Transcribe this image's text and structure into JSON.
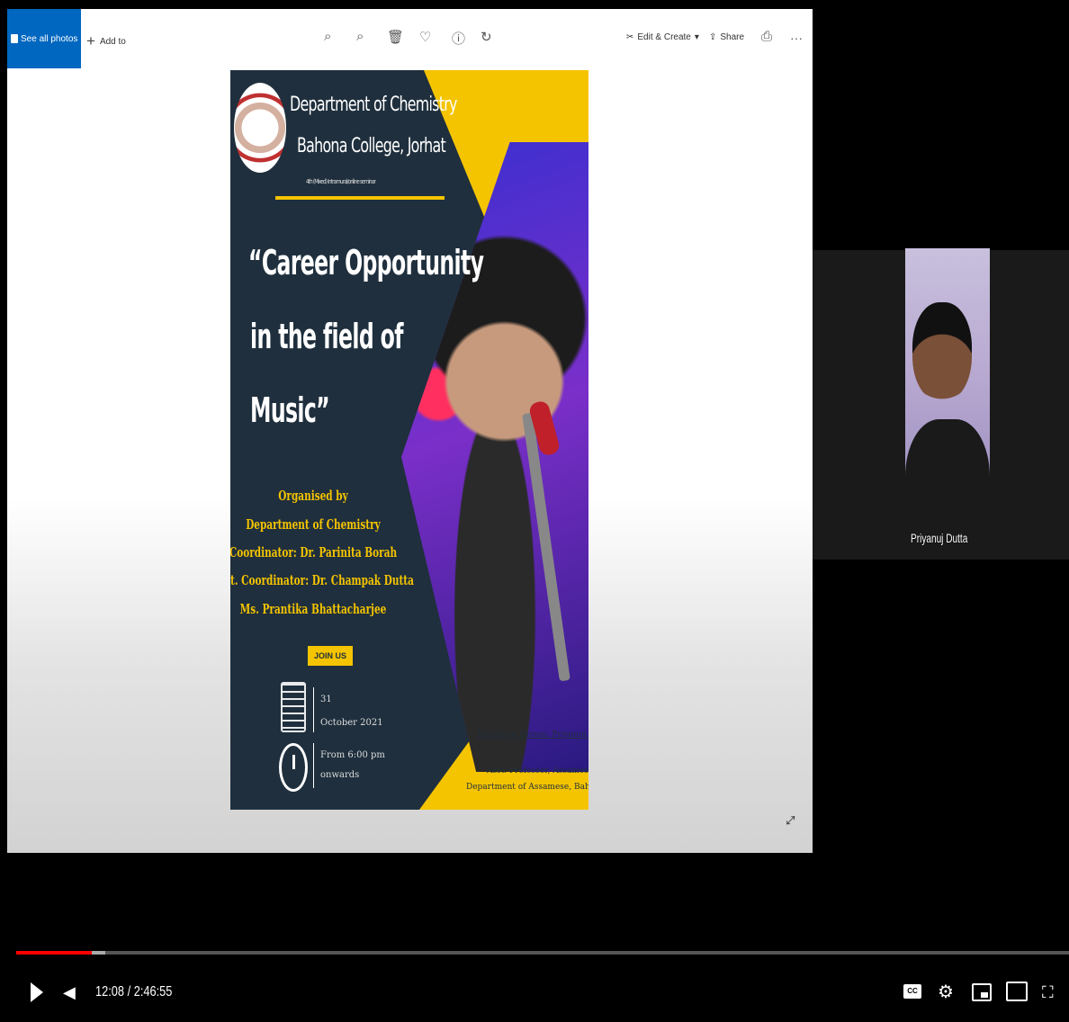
{
  "viewer": {
    "see_all_label": "See all photos",
    "add_to_label": "Add to",
    "edit_create_label": "Edit & Create",
    "share_label": "Share",
    "toolbar_icons": [
      "zoom-in-icon",
      "zoom-out-icon",
      "delete-icon",
      "favorite-icon",
      "info-icon",
      "rotate-icon"
    ]
  },
  "poster": {
    "dept_line1": "Department of Chemistry",
    "dept_line2": "Bahona College, Jorhat",
    "dept_line3": "4th (Mixed) Intramural/online seminar",
    "title_line1": "“Career Opportunity",
    "title_line2": "in the field of",
    "title_line3": "Music”",
    "organised_by": "Organised by",
    "organiser": "Department of Chemistry",
    "coordinator": "Coordinator: Dr. Parinita Borah",
    "asst_coordinator": "Asst. Coordinator: Dr. Champak Dutta",
    "member": "Ms. Prantika Bhattacharjee",
    "join_label": "JOIN US",
    "date_day": "31",
    "date_month": "October 2021",
    "time_line1": "From 6:00 pm",
    "time_line2": "onwards",
    "resource_person": "Resource Person: Priyanuj Dutta",
    "resource_role1": "Asst. Professor, Assamese",
    "resource_role2": "Department of Assamese, Bahona College"
  },
  "participant": {
    "name": "Priyanuj Dutta"
  },
  "player": {
    "time_display": "12:08 / 2:46:55",
    "progress_fraction": 0.072,
    "buffer_fraction": 0.085,
    "cc_label": "CC",
    "accent_color": "#ff0000"
  },
  "colors": {
    "poster_navy": "#1f2f3d",
    "poster_yellow": "#f5c400",
    "viewer_blue": "#0067c0"
  }
}
